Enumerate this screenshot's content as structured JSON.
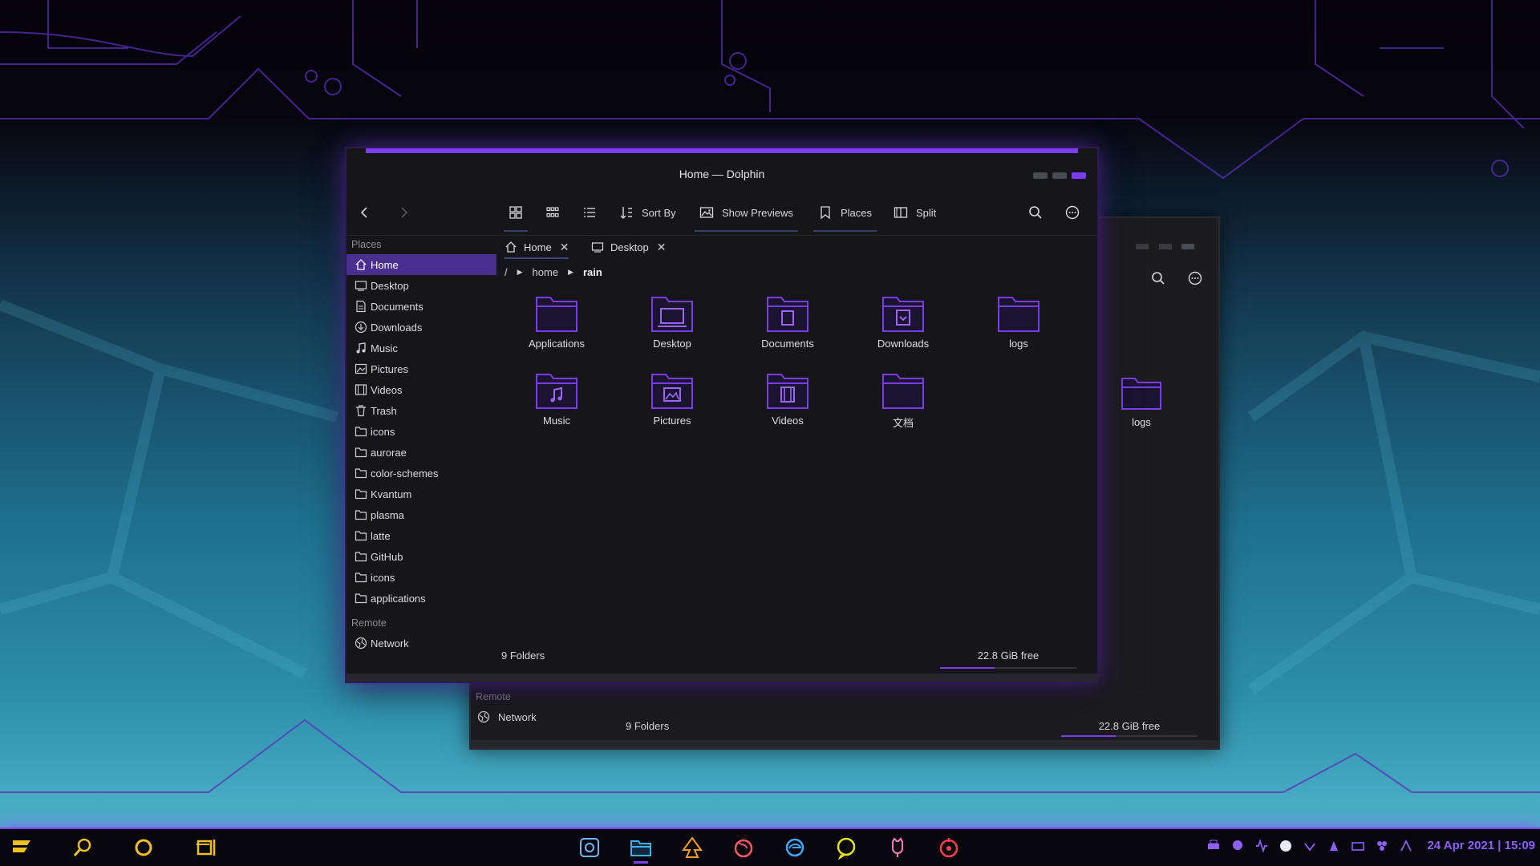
{
  "window": {
    "title": "Home — Dolphin"
  },
  "toolbar": {
    "sort_by": "Sort By",
    "show_previews": "Show Previews",
    "places": "Places",
    "split": "Split"
  },
  "sidebar": {
    "places_heading": "Places",
    "items": [
      "Home",
      "Desktop",
      "Documents",
      "Downloads",
      "Music",
      "Pictures",
      "Videos",
      "Trash",
      "icons",
      "aurorae",
      "color-schemes",
      "Kvantum",
      "plasma",
      "latte",
      "GitHub",
      "icons",
      "applications"
    ],
    "remote_heading": "Remote",
    "network": "Network"
  },
  "tabs": [
    {
      "label": "Home"
    },
    {
      "label": "Desktop"
    }
  ],
  "breadcrumb": {
    "root": "/",
    "parts": [
      "home",
      "rain"
    ]
  },
  "folders": [
    "Applications",
    "Desktop",
    "Documents",
    "Downloads",
    "logs",
    "Music",
    "Pictures",
    "Videos",
    "文档"
  ],
  "status": {
    "count": "9 Folders",
    "free": "22.8 GiB free",
    "used_fraction": 0.4
  },
  "back_window": {
    "folder": "logs",
    "remote_heading": "Remote",
    "network": "Network",
    "count": "9 Folders",
    "free": "22.8 GiB free"
  },
  "taskbar": {
    "clock": "24 Apr 2021 | 15:09"
  },
  "colors": {
    "accent": "#7b3df0",
    "selection": "#4a2f8f",
    "folder": "#7a3ee8"
  }
}
